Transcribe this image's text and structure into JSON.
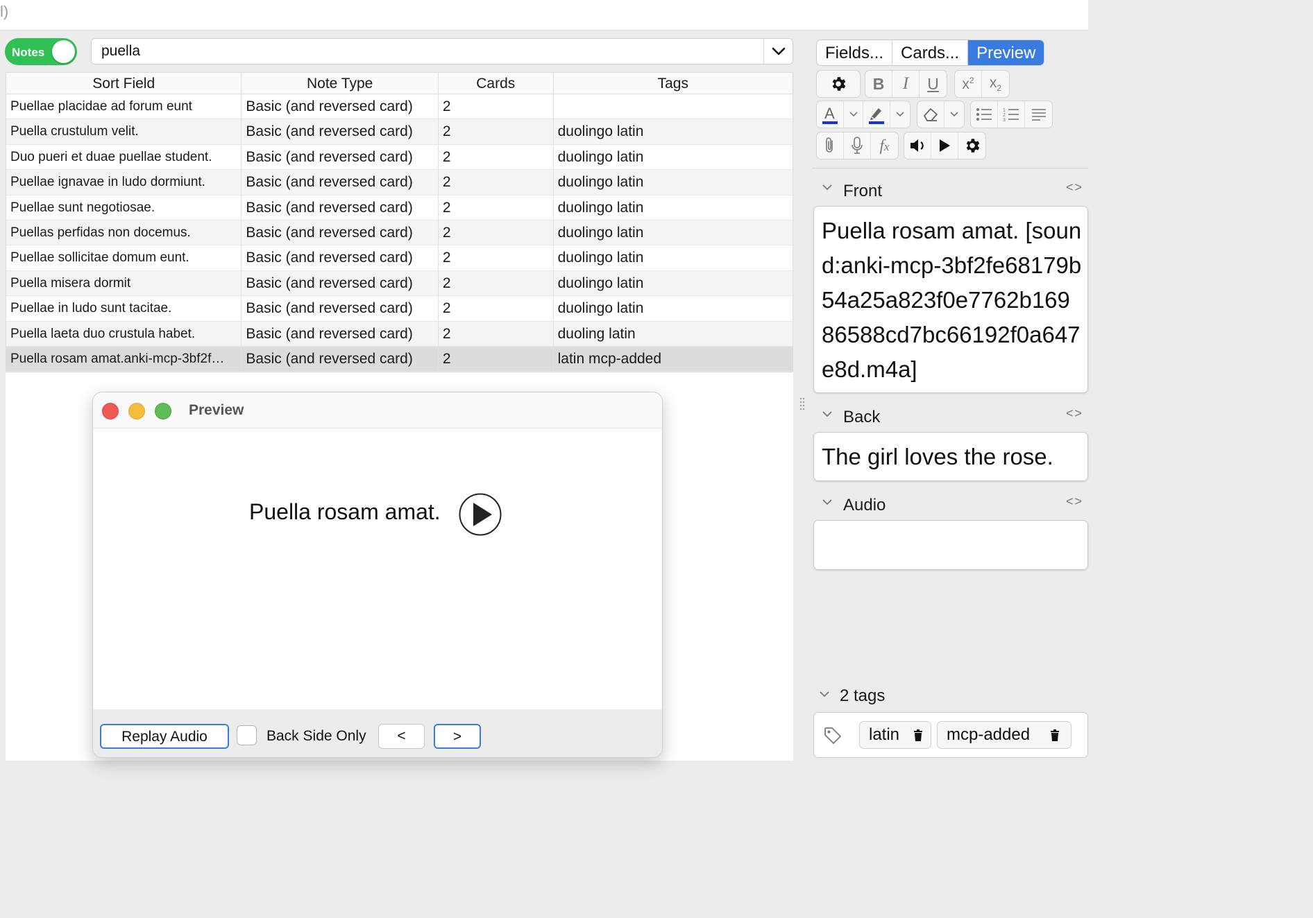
{
  "topbar": {
    "fragment": "l)"
  },
  "left": {
    "notes_toggle_label": "Notes",
    "search_value": "puella",
    "table": {
      "headers": [
        "Sort Field",
        "Note Type",
        "Cards",
        "Tags"
      ],
      "rows": [
        [
          "Puellae placidae ad forum eunt",
          "Basic (and reversed card)",
          "2",
          ""
        ],
        [
          "Puella crustulum velit.",
          "Basic (and reversed card)",
          "2",
          "duolingo latin"
        ],
        [
          "Duo pueri et duae puellae student.",
          "Basic (and reversed card)",
          "2",
          "duolingo latin"
        ],
        [
          "Puellae ignavae in ludo dormiunt.",
          "Basic (and reversed card)",
          "2",
          "duolingo latin"
        ],
        [
          "Puellae sunt negotiosae.",
          "Basic (and reversed card)",
          "2",
          "duolingo latin"
        ],
        [
          "Puellas perfidas non docemus.",
          "Basic (and reversed card)",
          "2",
          "duolingo latin"
        ],
        [
          "Puellae sollicitae domum eunt.",
          "Basic (and reversed card)",
          "2",
          "duolingo latin"
        ],
        [
          "Puella misera dormit",
          "Basic (and reversed card)",
          "2",
          "duolingo latin"
        ],
        [
          "Puellae in ludo sunt tacitae.",
          "Basic (and reversed card)",
          "2",
          "duolingo latin"
        ],
        [
          "Puella laeta duo crustula habet.",
          "Basic (and reversed card)",
          "2",
          "duoling latin"
        ],
        [
          "Puella rosam amat.anki-mcp-3bf2f…",
          "Basic (and reversed card)",
          "2",
          "latin mcp-added"
        ]
      ]
    }
  },
  "preview_window": {
    "title": "Preview",
    "card_text": "Puella rosam amat.",
    "replay_label": "Replay Audio",
    "back_only_label": "Back Side Only",
    "prev_label": "<",
    "next_label": ">"
  },
  "editor": {
    "tabs": [
      "Fields...",
      "Cards...",
      "Preview"
    ],
    "fields": {
      "front": {
        "label": "Front",
        "value": "Puella rosam amat. [sound:anki-mcp-3bf2fe68179b54a25a823f0e7762b16986588cd7bc66192f0a647e8d.m4a]"
      },
      "back": {
        "label": "Back",
        "value": "The girl loves the rose."
      },
      "audio": {
        "label": "Audio",
        "value": ""
      }
    },
    "code_toggle": "<>",
    "tags_count": "2 tags",
    "tags": [
      "latin",
      "mcp-added"
    ],
    "toolbar_icons": [
      "gear-icon",
      "bold-icon",
      "italic-icon",
      "underline-icon",
      "superscript-icon",
      "subscript-icon",
      "text-color-icon",
      "highlight-icon",
      "eraser-icon",
      "bullet-list-icon",
      "numbered-list-icon",
      "align-icon",
      "attachment-icon",
      "microphone-icon",
      "formula-icon",
      "audio-icon",
      "play-icon",
      "settings-icon"
    ]
  },
  "colors": {
    "toggle_green": "#30c054",
    "accent_blue": "#3a7be0",
    "color_underline": "#1533d6"
  }
}
